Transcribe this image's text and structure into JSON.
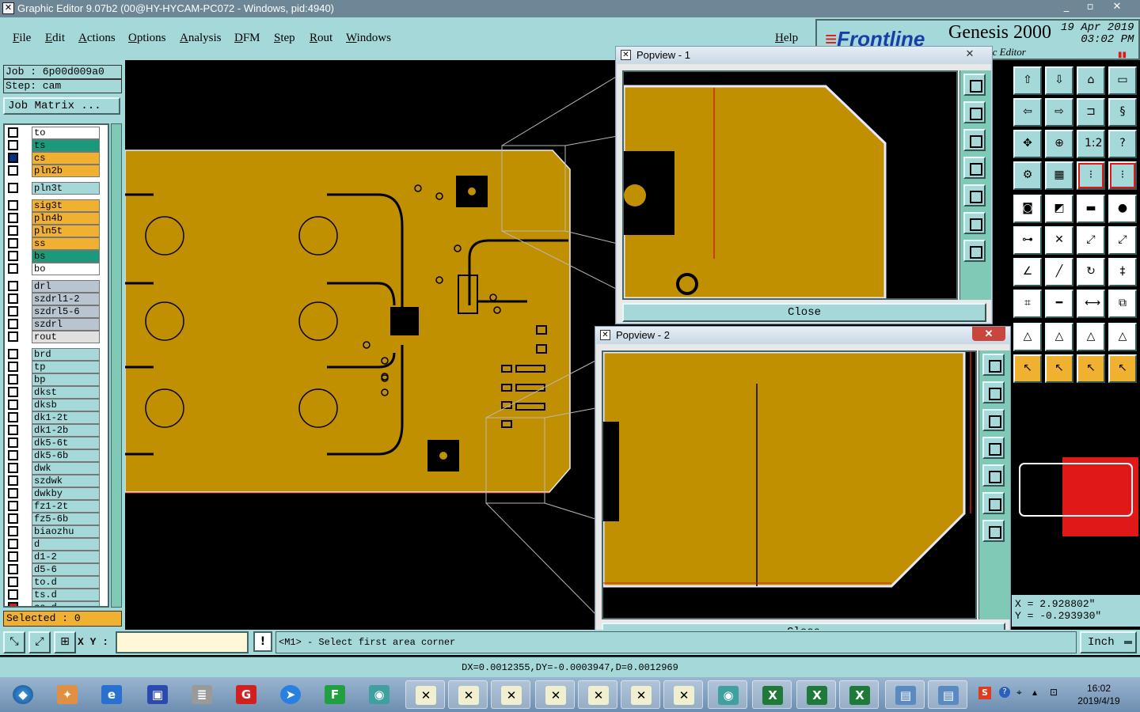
{
  "window": {
    "title": "Graphic Editor 9.07b2 (00@HY-HYCAM-PC072 - Windows, pid:4940)",
    "controls": [
      "_",
      "▫",
      "✕"
    ]
  },
  "menu": {
    "items": [
      "File",
      "Edit",
      "Actions",
      "Options",
      "Analysis",
      "DFM",
      "Step",
      "Rout",
      "Windows"
    ],
    "help": "Help"
  },
  "brand": {
    "logo": "Frontline",
    "product": "Genesis 2000",
    "subtitle": "ic Editor",
    "date": "19 Apr 2019",
    "time": "03:02 PM"
  },
  "job": {
    "job_label": "Job : 6p00d009a0",
    "step_label": "Step: cam",
    "matrix_button": "Job Matrix ..."
  },
  "layers": [
    {
      "name": "to",
      "color": "#ffffff",
      "state": "off"
    },
    {
      "name": "ts",
      "color": "#1a9a7a",
      "state": "off"
    },
    {
      "name": "cs",
      "color": "#f0b030",
      "state": "sel"
    },
    {
      "name": "pln2b",
      "color": "#f0b030",
      "state": "off"
    },
    {
      "name": "pln3t",
      "color": "#a5d8d8",
      "state": "off"
    },
    {
      "name": "sig3t",
      "color": "#f0b030",
      "state": "off"
    },
    {
      "name": "pln4b",
      "color": "#f0b030",
      "state": "off"
    },
    {
      "name": "pln5t",
      "color": "#f0b030",
      "state": "off"
    },
    {
      "name": "ss",
      "color": "#f0b030",
      "state": "off"
    },
    {
      "name": "bs",
      "color": "#1a9a7a",
      "state": "off"
    },
    {
      "name": "bo",
      "color": "#ffffff",
      "state": "off"
    },
    {
      "name": "drl",
      "color": "#b8c4d0",
      "state": "off"
    },
    {
      "name": "szdrl1-2",
      "color": "#b8c4d0",
      "state": "off"
    },
    {
      "name": "szdrl5-6",
      "color": "#b8c4d0",
      "state": "off"
    },
    {
      "name": "szdrl",
      "color": "#b8c4d0",
      "state": "off"
    },
    {
      "name": "rout",
      "color": "#e0e0e0",
      "state": "off"
    },
    {
      "name": "brd",
      "color": "#a5d8d8",
      "state": "off"
    },
    {
      "name": "tp",
      "color": "#a5d8d8",
      "state": "off"
    },
    {
      "name": "bp",
      "color": "#a5d8d8",
      "state": "off"
    },
    {
      "name": "dkst",
      "color": "#a5d8d8",
      "state": "off"
    },
    {
      "name": "dksb",
      "color": "#a5d8d8",
      "state": "off"
    },
    {
      "name": "dk1-2t",
      "color": "#a5d8d8",
      "state": "off"
    },
    {
      "name": "dk1-2b",
      "color": "#a5d8d8",
      "state": "off"
    },
    {
      "name": "dk5-6t",
      "color": "#a5d8d8",
      "state": "off"
    },
    {
      "name": "dk5-6b",
      "color": "#a5d8d8",
      "state": "off"
    },
    {
      "name": "dwk",
      "color": "#a5d8d8",
      "state": "off"
    },
    {
      "name": "szdwk",
      "color": "#a5d8d8",
      "state": "off"
    },
    {
      "name": "dwkby",
      "color": "#a5d8d8",
      "state": "off"
    },
    {
      "name": "fz1-2t",
      "color": "#a5d8d8",
      "state": "off"
    },
    {
      "name": "fz5-6b",
      "color": "#a5d8d8",
      "state": "off"
    },
    {
      "name": "biaozhu",
      "color": "#a5d8d8",
      "state": "off"
    },
    {
      "name": "d",
      "color": "#a5d8d8",
      "state": "off"
    },
    {
      "name": "d1-2",
      "color": "#a5d8d8",
      "state": "off"
    },
    {
      "name": "d5-6",
      "color": "#a5d8d8",
      "state": "off"
    },
    {
      "name": "to.d",
      "color": "#a5d8d8",
      "state": "off"
    },
    {
      "name": "ts.d",
      "color": "#a5d8d8",
      "state": "off"
    },
    {
      "name": "cs.d",
      "color": "#a5d8d8",
      "state": "red"
    }
  ],
  "selected": "Selected : 0",
  "popview1": {
    "title": "Popview - 1",
    "close_label": "Close"
  },
  "popview2": {
    "title": "Popview - 2",
    "close_label": "Close"
  },
  "coords": {
    "x": "X = 2.928802\"",
    "y": "Y = -0.293930\""
  },
  "status": {
    "xy_label": "X Y :",
    "xy_value": "",
    "prompt_icon": "!",
    "prompt": "<M1> - Select first area corner",
    "unit": "Inch",
    "measure": "DX=0.0012355,DY=-0.0003947,D=0.0012969"
  },
  "taskbar": {
    "time": "16:02",
    "date": "2019/4/19"
  },
  "colors": {
    "copper": "#c09000",
    "panel": "#a5d8d8",
    "highlight": "#f0b030"
  }
}
